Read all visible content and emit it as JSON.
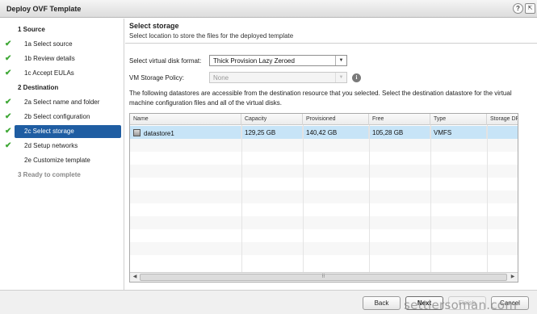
{
  "window": {
    "title": "Deploy OVF Template",
    "help_icon": "?",
    "expand_icon": "⇱"
  },
  "sidebar": {
    "steps": [
      {
        "label": "1  Source",
        "kind": "section",
        "done": false
      },
      {
        "label": "1a  Select source",
        "kind": "sub",
        "done": true
      },
      {
        "label": "1b  Review details",
        "kind": "sub",
        "done": true
      },
      {
        "label": "1c  Accept EULAs",
        "kind": "sub",
        "done": true
      },
      {
        "label": "2  Destination",
        "kind": "section",
        "done": false
      },
      {
        "label": "2a  Select name and folder",
        "kind": "sub",
        "done": true
      },
      {
        "label": "2b  Select configuration",
        "kind": "sub",
        "done": true
      },
      {
        "label": "2c  Select storage",
        "kind": "sub",
        "done": true,
        "selected": true
      },
      {
        "label": "2d  Setup networks",
        "kind": "sub",
        "done": true
      },
      {
        "label": "2e  Customize template",
        "kind": "sub",
        "done": false
      },
      {
        "label": "3  Ready to complete",
        "kind": "section",
        "done": false,
        "disabled": true
      }
    ]
  },
  "main": {
    "title": "Select storage",
    "subtitle": "Select location to store the files for the deployed template",
    "disk_format": {
      "label": "Select virtual disk format:",
      "value": "Thick Provision Lazy Zeroed"
    },
    "storage_policy": {
      "label": "VM Storage Policy:",
      "value": "None"
    },
    "description": "The following datastores are accessible from the destination resource that you selected. Select the destination datastore for the virtual machine configuration files and all of the virtual disks.",
    "table": {
      "columns": [
        "Name",
        "Capacity",
        "Provisioned",
        "Free",
        "Type",
        "Storage DRS"
      ],
      "rows": [
        {
          "name": "datastore1",
          "capacity": "129,25 GB",
          "provisioned": "140,42 GB",
          "free": "105,28 GB",
          "type": "VMFS",
          "drs": ""
        }
      ],
      "scroll_grip": "⠿"
    }
  },
  "footer": {
    "back": "Back",
    "next": "Next",
    "finish": "Finish",
    "cancel": "Cancel"
  },
  "watermark": "settlersoman.com",
  "colors": {
    "selected_step": "#1f5da2",
    "selected_row": "#c7e4f7",
    "check": "#3fa836"
  }
}
